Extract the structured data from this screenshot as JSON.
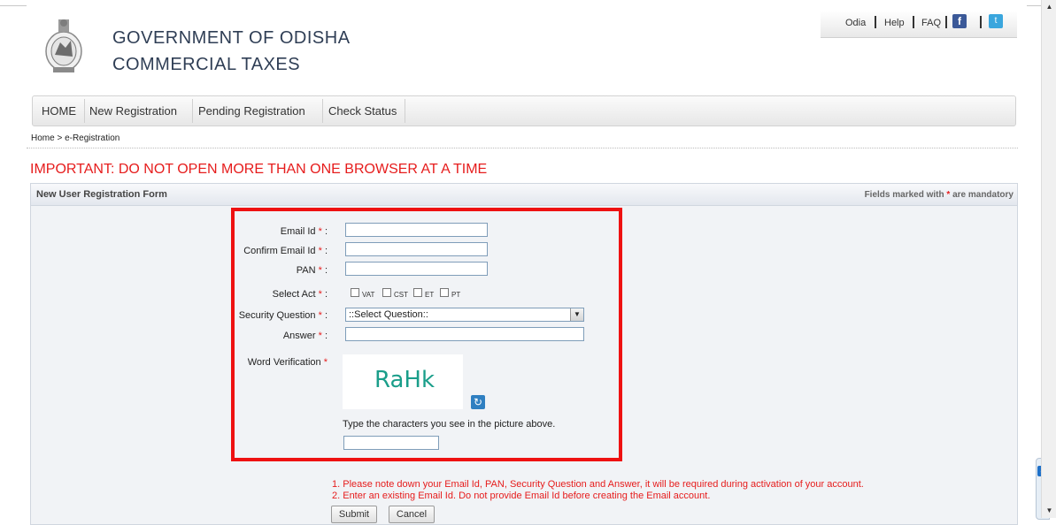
{
  "header": {
    "org_line1": "GOVERNMENT OF ODISHA",
    "org_line2": "COMMERCIAL TAXES",
    "emblem_icon": "odisha-emblem-icon"
  },
  "toplinks": {
    "odia": "Odia",
    "help": "Help",
    "faq": "FAQ",
    "facebook_icon": "facebook-icon",
    "twitter_icon": "twitter-icon"
  },
  "nav": {
    "items": [
      "HOME",
      "New Registration",
      "Pending Registration",
      "Check Status"
    ]
  },
  "breadcrumb": "Home > e-Registration",
  "important": "IMPORTANT: DO NOT OPEN MORE THAN ONE BROWSER AT A TIME",
  "form": {
    "title": "New User Registration Form",
    "mandatory_prefix": "Fields marked with ",
    "mandatory_star": "*",
    "mandatory_suffix": " are mandatory",
    "email_label": "Email Id",
    "confirm_email_label": "Confirm Email Id",
    "pan_label": "PAN",
    "select_act_label": "Select Act",
    "acts": [
      "VAT",
      "CST",
      "ET",
      "PT"
    ],
    "security_question_label": "Security Question",
    "security_question_value": "::Select Question::",
    "answer_label": "Answer",
    "word_verification_label": "Word Verification",
    "captcha_text": "RaHk",
    "captcha_hint": "Type the characters you see in the picture above.",
    "star": "*",
    "colon": ":"
  },
  "notes": [
    "1. Please note down your Email Id, PAN, Security Question and Answer, it will be required during activation of your account.",
    "2. Enter an existing Email Id. Do not provide Email Id before creating the Email account."
  ],
  "buttons": {
    "submit": "Submit",
    "cancel": "Cancel"
  },
  "colors": {
    "warning_red": "#e61c1c",
    "highlight_box": "#ee1111"
  }
}
